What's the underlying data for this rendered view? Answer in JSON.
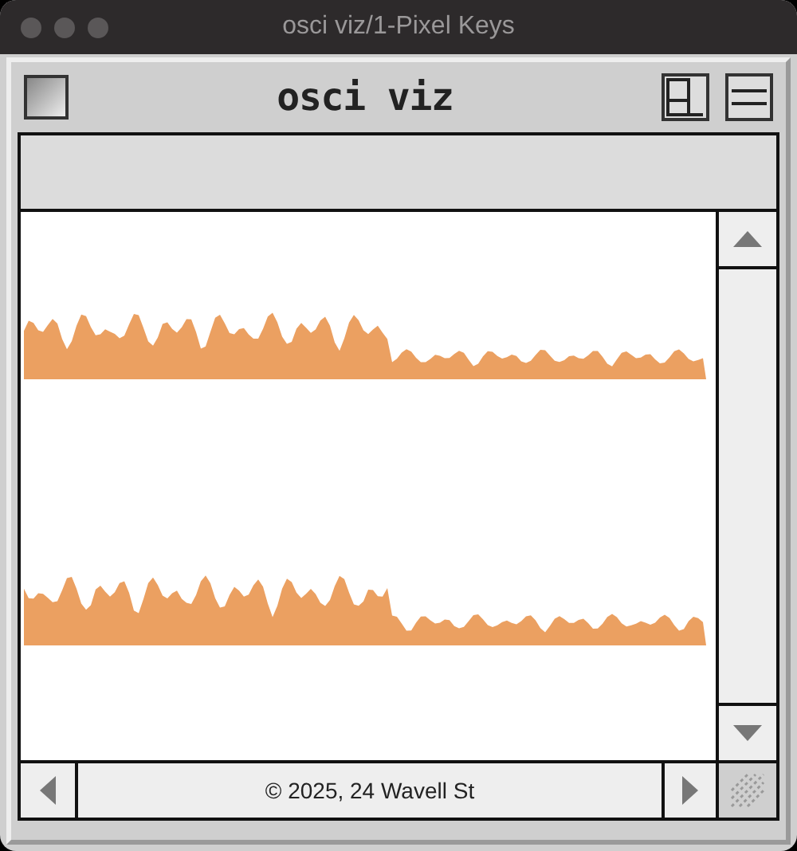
{
  "window": {
    "title": "osci viz/1-Pixel Keys"
  },
  "app": {
    "title": "osci viz",
    "footer": "© 2025, 24 Wavell St"
  }
}
